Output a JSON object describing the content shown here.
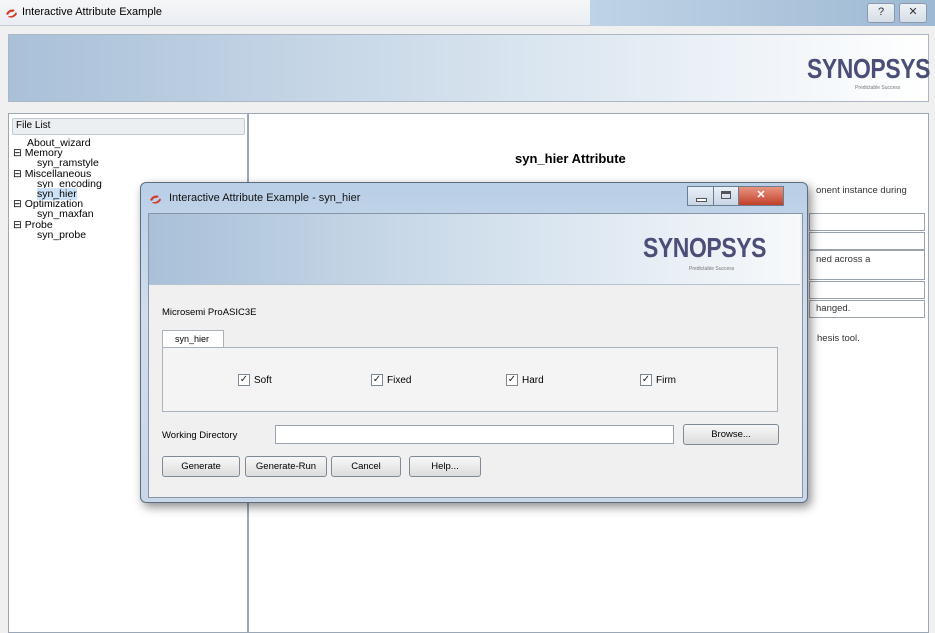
{
  "window": {
    "title": "Interactive Attribute Example"
  },
  "brand": {
    "name": "SYNOPSYS",
    "tagline": "Predictable Success"
  },
  "file_list": {
    "header": "File List",
    "items": [
      {
        "label": "About_wizard",
        "level": 1
      },
      {
        "label": "Memory",
        "level": 0
      },
      {
        "label": "syn_ramstyle",
        "level": 1
      },
      {
        "label": "Miscellaneous",
        "level": 0
      },
      {
        "label": "syn_encoding",
        "level": 1
      },
      {
        "label": "syn_hier",
        "level": 1,
        "selected": true
      },
      {
        "label": "Optimization",
        "level": 0
      },
      {
        "label": "syn_maxfan",
        "level": 1
      },
      {
        "label": "Probe",
        "level": 0
      },
      {
        "label": "syn_probe",
        "level": 1
      }
    ]
  },
  "content": {
    "heading": "syn_hier Attribute",
    "fragments": [
      "onent instance during",
      "ned across a",
      "hanged.",
      "hesis tool."
    ]
  },
  "dialog": {
    "title": "Interactive Attribute Example - syn_hier",
    "device": "Microsemi ProASIC3E",
    "tab": "syn_hier",
    "options": [
      {
        "label": "Soft",
        "checked": true
      },
      {
        "label": "Fixed",
        "checked": true
      },
      {
        "label": "Hard",
        "checked": true
      },
      {
        "label": "Firm",
        "checked": true
      }
    ],
    "working_dir_label": "Working Directory",
    "working_dir_value": "",
    "browse": "Browse...",
    "buttons": {
      "generate": "Generate",
      "generate_run": "Generate-Run",
      "cancel": "Cancel",
      "help": "Help..."
    }
  }
}
